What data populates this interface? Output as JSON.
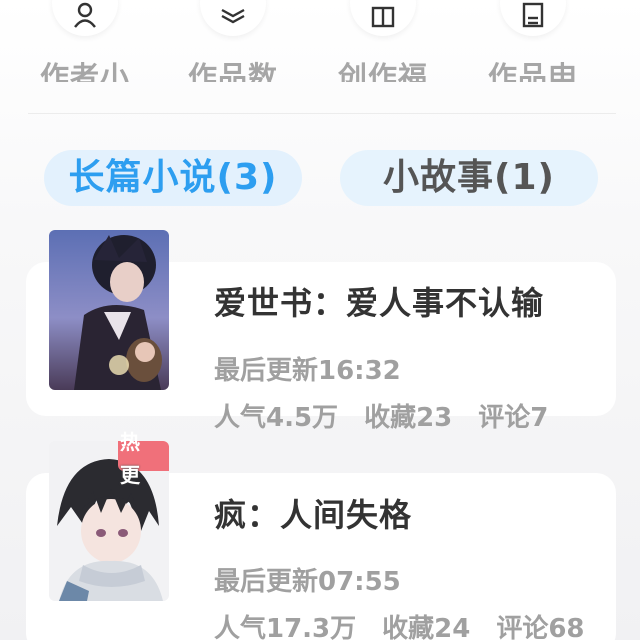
{
  "tools": [
    {
      "label": "作者小",
      "icon": "user-icon"
    },
    {
      "label": "作品数",
      "icon": "layers-icon"
    },
    {
      "label": "创作福",
      "icon": "gift-icon"
    },
    {
      "label": "作品申",
      "icon": "document-icon"
    }
  ],
  "tabs": [
    {
      "label": "长篇小说(3)",
      "active": true
    },
    {
      "label": "小故事(1)",
      "active": false
    }
  ],
  "books": [
    {
      "title": "爱世书：爱人事不认输",
      "updated": "最后更新16:32",
      "popularity": "人气4.5万",
      "favorites": "收藏23",
      "comments": "评论7",
      "badge": ""
    },
    {
      "title": "疯：人间失格",
      "updated": "最后更新07:55",
      "popularity": "人气17.3万",
      "favorites": "收藏24",
      "comments": "评论68",
      "badge_line1": "热",
      "badge_line2": "更"
    }
  ],
  "colors": {
    "accent": "#2d9ef0",
    "tab_bg": "#e3f1fd",
    "badge": "#f0707a",
    "muted_text": "#a0a0a0",
    "title_text": "#333333"
  }
}
